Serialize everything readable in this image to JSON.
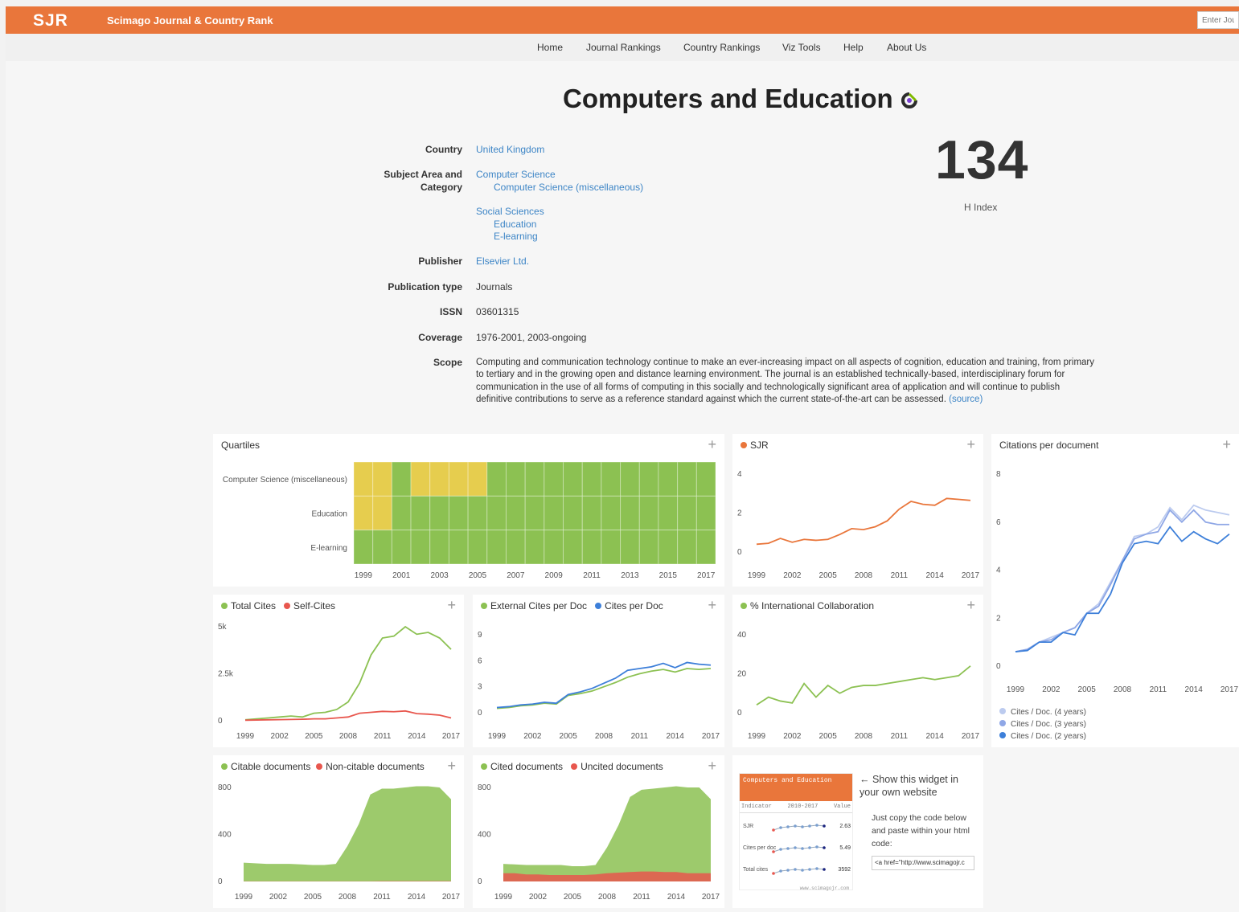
{
  "header": {
    "logo": "SJR",
    "site_name": "Scimago Journal & Country Rank",
    "search_placeholder": "Enter Journal Title, ISSN or Publisher Name"
  },
  "nav": [
    "Home",
    "Journal Rankings",
    "Country Rankings",
    "Viz Tools",
    "Help",
    "About Us"
  ],
  "journal": {
    "title": "Computers and Education",
    "h_index": "134",
    "h_index_label": "H Index",
    "fields": {
      "country_label": "Country",
      "country": "United Kingdom",
      "subject_label_1": "Subject Area and",
      "subject_label_2": "Category",
      "area1": "Computer Science",
      "area1_cat1": "Computer Science (miscellaneous)",
      "area2": "Social Sciences",
      "area2_cat1": "Education",
      "area2_cat2": "E-learning",
      "publisher_label": "Publisher",
      "publisher": "Elsevier Ltd.",
      "pubtype_label": "Publication type",
      "pubtype": "Journals",
      "issn_label": "ISSN",
      "issn": "03601315",
      "coverage_label": "Coverage",
      "coverage": "1976-2001, 2003-ongoing",
      "scope_label": "Scope",
      "scope": "Computing and communication technology continue to make an ever-increasing impact on all aspects of cognition, education and training, from primary to tertiary and in the growing open and distance learning environment. The journal is an established technically-based, interdisciplinary forum for communication in the use of all forms of computing in this socially and technologically significant area of application and will continue to publish definitive contributions to serve as a reference standard against which the current state-of-the-art can be assessed.",
      "scope_source": "(source)"
    }
  },
  "colors": {
    "orange": "#e9763b",
    "green": "#8cc152",
    "q2yellow": "#e6cd4e",
    "blue": "#3d7fd9",
    "red": "#e8574e",
    "link": "#3d85c6"
  },
  "chart_data": [
    {
      "type": "heatmap",
      "title": "Quartiles",
      "rows": [
        "Computer Science (miscellaneous)",
        "Education",
        "E-learning"
      ],
      "x_ticks": [
        "1999",
        "2001",
        "2003",
        "2005",
        "2007",
        "2009",
        "2011",
        "2013",
        "2015",
        "2017"
      ],
      "years": [
        1999,
        2000,
        2001,
        2002,
        2003,
        2004,
        2005,
        2006,
        2007,
        2008,
        2009,
        2010,
        2011,
        2012,
        2013,
        2014,
        2015,
        2016,
        2017
      ],
      "values": [
        [
          "Q2",
          "Q2",
          "Q1",
          "Q2",
          "Q2",
          "Q2",
          "Q2",
          "Q1",
          "Q1",
          "Q1",
          "Q1",
          "Q1",
          "Q1",
          "Q1",
          "Q1",
          "Q1",
          "Q1",
          "Q1",
          "Q1"
        ],
        [
          "Q2",
          "Q2",
          "Q1",
          "Q1",
          "Q1",
          "Q1",
          "Q1",
          "Q1",
          "Q1",
          "Q1",
          "Q1",
          "Q1",
          "Q1",
          "Q1",
          "Q1",
          "Q1",
          "Q1",
          "Q1",
          "Q1"
        ],
        [
          "Q1",
          "Q1",
          "Q1",
          "Q1",
          "Q1",
          "Q1",
          "Q1",
          "Q1",
          "Q1",
          "Q1",
          "Q1",
          "Q1",
          "Q1",
          "Q1",
          "Q1",
          "Q1",
          "Q1",
          "Q1",
          "Q1"
        ]
      ],
      "legend_colors": {
        "Q1": "#8cc152",
        "Q2": "#e6cd4e"
      }
    },
    {
      "type": "line",
      "title": "SJR",
      "x": [
        1999,
        2000,
        2001,
        2002,
        2003,
        2004,
        2005,
        2006,
        2007,
        2008,
        2009,
        2010,
        2011,
        2012,
        2013,
        2014,
        2015,
        2016,
        2017
      ],
      "series": [
        {
          "name": "SJR",
          "color": "#e9763b",
          "values": [
            0.4,
            0.45,
            0.7,
            0.5,
            0.65,
            0.6,
            0.65,
            0.9,
            1.2,
            1.15,
            1.3,
            1.6,
            2.2,
            2.6,
            2.45,
            2.4,
            2.75,
            2.7,
            2.65
          ]
        }
      ],
      "ylim": [
        0,
        4
      ],
      "y_ticks": [
        "0",
        "2",
        "4"
      ],
      "x_ticks": [
        "1999",
        "2002",
        "2005",
        "2008",
        "2011",
        "2014",
        "2017"
      ]
    },
    {
      "type": "line",
      "title": "Citations per document",
      "x": [
        1999,
        2000,
        2001,
        2002,
        2003,
        2004,
        2005,
        2006,
        2007,
        2008,
        2009,
        2010,
        2011,
        2012,
        2013,
        2014,
        2015,
        2016,
        2017
      ],
      "series": [
        {
          "name": "Cites / Doc. (4 years)",
          "color": "#bccbef",
          "values": [
            0.6,
            0.7,
            1.0,
            1.2,
            1.4,
            1.6,
            2.2,
            2.6,
            3.5,
            4.4,
            5.4,
            5.5,
            5.8,
            6.6,
            6.1,
            6.7,
            6.5,
            6.4,
            6.3
          ]
        },
        {
          "name": "Cites / Doc. (3 years)",
          "color": "#8fa7e6",
          "values": [
            0.6,
            0.7,
            1.0,
            1.1,
            1.4,
            1.6,
            2.2,
            2.5,
            3.4,
            4.4,
            5.3,
            5.5,
            5.6,
            6.5,
            6.0,
            6.5,
            6.0,
            5.9,
            5.9
          ]
        },
        {
          "name": "Cites / Doc. (2 years)",
          "color": "#3d7fd9",
          "values": [
            0.6,
            0.65,
            1.0,
            1.0,
            1.4,
            1.3,
            2.2,
            2.2,
            3.0,
            4.3,
            5.1,
            5.2,
            5.1,
            5.8,
            5.2,
            5.6,
            5.3,
            5.1,
            5.5
          ]
        }
      ],
      "ylim": [
        0,
        8
      ],
      "y_ticks": [
        "0",
        "2",
        "4",
        "6",
        "8"
      ],
      "x_ticks": [
        "1999",
        "2002",
        "2005",
        "2008",
        "2011",
        "2014",
        "2017"
      ]
    },
    {
      "type": "line",
      "title": "",
      "x": [
        1999,
        2000,
        2001,
        2002,
        2003,
        2004,
        2005,
        2006,
        2007,
        2008,
        2009,
        2010,
        2011,
        2012,
        2013,
        2014,
        2015,
        2016,
        2017
      ],
      "series": [
        {
          "name": "Total Cites",
          "color": "#8cc152",
          "values": [
            50,
            100,
            150,
            200,
            250,
            200,
            400,
            450,
            600,
            1000,
            2000,
            3500,
            4400,
            4500,
            5000,
            4600,
            4700,
            4400,
            3800
          ]
        },
        {
          "name": "Self-Cites",
          "color": "#e8574e",
          "values": [
            30,
            40,
            50,
            60,
            70,
            80,
            100,
            100,
            150,
            200,
            400,
            450,
            500,
            480,
            520,
            380,
            350,
            300,
            150
          ]
        }
      ],
      "ylim": [
        0,
        5000
      ],
      "y_ticks": [
        "0",
        "2.5k",
        "5k"
      ],
      "x_ticks": [
        "1999",
        "2002",
        "2005",
        "2008",
        "2011",
        "2014",
        "2017"
      ]
    },
    {
      "type": "line",
      "title": "",
      "x": [
        1999,
        2000,
        2001,
        2002,
        2003,
        2004,
        2005,
        2006,
        2007,
        2008,
        2009,
        2010,
        2011,
        2012,
        2013,
        2014,
        2015,
        2016,
        2017
      ],
      "series": [
        {
          "name": "External Cites per Doc",
          "color": "#8cc152",
          "values": [
            0.5,
            0.6,
            0.8,
            0.9,
            1.1,
            1.0,
            2.0,
            2.2,
            2.5,
            3.0,
            3.5,
            4.1,
            4.5,
            4.8,
            5.0,
            4.7,
            5.1,
            5.0,
            5.1
          ]
        },
        {
          "name": "Cites per Doc",
          "color": "#3d7fd9",
          "values": [
            0.6,
            0.7,
            0.9,
            1.0,
            1.2,
            1.1,
            2.1,
            2.4,
            2.8,
            3.4,
            4.0,
            4.9,
            5.1,
            5.3,
            5.7,
            5.2,
            5.8,
            5.6,
            5.5
          ]
        }
      ],
      "ylim": [
        0,
        9
      ],
      "y_ticks": [
        "0",
        "3",
        "6",
        "9"
      ],
      "x_ticks": [
        "1999",
        "2002",
        "2005",
        "2008",
        "2011",
        "2014",
        "2017"
      ]
    },
    {
      "type": "line",
      "title": "",
      "x": [
        1999,
        2000,
        2001,
        2002,
        2003,
        2004,
        2005,
        2006,
        2007,
        2008,
        2009,
        2010,
        2011,
        2012,
        2013,
        2014,
        2015,
        2016,
        2017
      ],
      "series": [
        {
          "name": "% International Collaboration",
          "color": "#8cc152",
          "values": [
            4,
            8,
            6,
            5,
            15,
            8,
            14,
            10,
            13,
            14,
            14,
            15,
            16,
            17,
            18,
            17,
            18,
            19,
            24
          ]
        }
      ],
      "ylim": [
        0,
        40
      ],
      "y_ticks": [
        "0",
        "20",
        "40"
      ],
      "x_ticks": [
        "1999",
        "2002",
        "2005",
        "2008",
        "2011",
        "2014",
        "2017"
      ]
    },
    {
      "type": "area",
      "title": "",
      "x": [
        1999,
        2000,
        2001,
        2002,
        2003,
        2004,
        2005,
        2006,
        2007,
        2008,
        2009,
        2010,
        2011,
        2012,
        2013,
        2014,
        2015,
        2016,
        2017
      ],
      "series": [
        {
          "name": "Citable documents",
          "color": "#8cc152",
          "values": [
            160,
            155,
            150,
            150,
            150,
            145,
            140,
            140,
            150,
            300,
            490,
            740,
            790,
            790,
            800,
            810,
            810,
            800,
            700
          ]
        },
        {
          "name": "Non-citable documents",
          "color": "#e8574e",
          "values": [
            2,
            2,
            2,
            2,
            2,
            2,
            2,
            2,
            2,
            2,
            2,
            2,
            3,
            3,
            3,
            3,
            3,
            3,
            3
          ]
        }
      ],
      "ylim": [
        0,
        800
      ],
      "y_ticks": [
        "0",
        "400",
        "800"
      ],
      "x_ticks": [
        "1999",
        "2002",
        "2005",
        "2008",
        "2011",
        "2014",
        "2017"
      ]
    },
    {
      "type": "area",
      "title": "",
      "x": [
        1999,
        2000,
        2001,
        2002,
        2003,
        2004,
        2005,
        2006,
        2007,
        2008,
        2009,
        2010,
        2011,
        2012,
        2013,
        2014,
        2015,
        2016,
        2017
      ],
      "series": [
        {
          "name": "Cited documents",
          "color": "#8cc152",
          "values": [
            150,
            145,
            140,
            140,
            140,
            140,
            130,
            130,
            140,
            290,
            480,
            720,
            780,
            790,
            800,
            810,
            800,
            800,
            700
          ]
        },
        {
          "name": "Uncited documents",
          "color": "#e8574e",
          "values": [
            70,
            70,
            60,
            60,
            55,
            55,
            55,
            55,
            60,
            70,
            75,
            80,
            85,
            85,
            80,
            80,
            70,
            70,
            70
          ]
        }
      ],
      "ylim": [
        0,
        800
      ],
      "y_ticks": [
        "0",
        "400",
        "800"
      ],
      "x_ticks": [
        "1999",
        "2002",
        "2005",
        "2008",
        "2011",
        "2014",
        "2017"
      ]
    }
  ],
  "widget": {
    "banner": "Computers and Education",
    "col_indicator": "Indicator",
    "col_years": "2010-2017",
    "col_value": "Value",
    "rows": [
      {
        "label": "SJR",
        "value": "2.63"
      },
      {
        "label": "Cites per doc",
        "value": "5.49"
      },
      {
        "label": "Total cites",
        "value": "3592"
      }
    ],
    "footer": "www.scimagojr.com",
    "title": "← Show this widget in your own website",
    "instructions": "Just copy the code below and paste within your html code:",
    "code": "<a href=\"http://www.scimagojr.c"
  }
}
